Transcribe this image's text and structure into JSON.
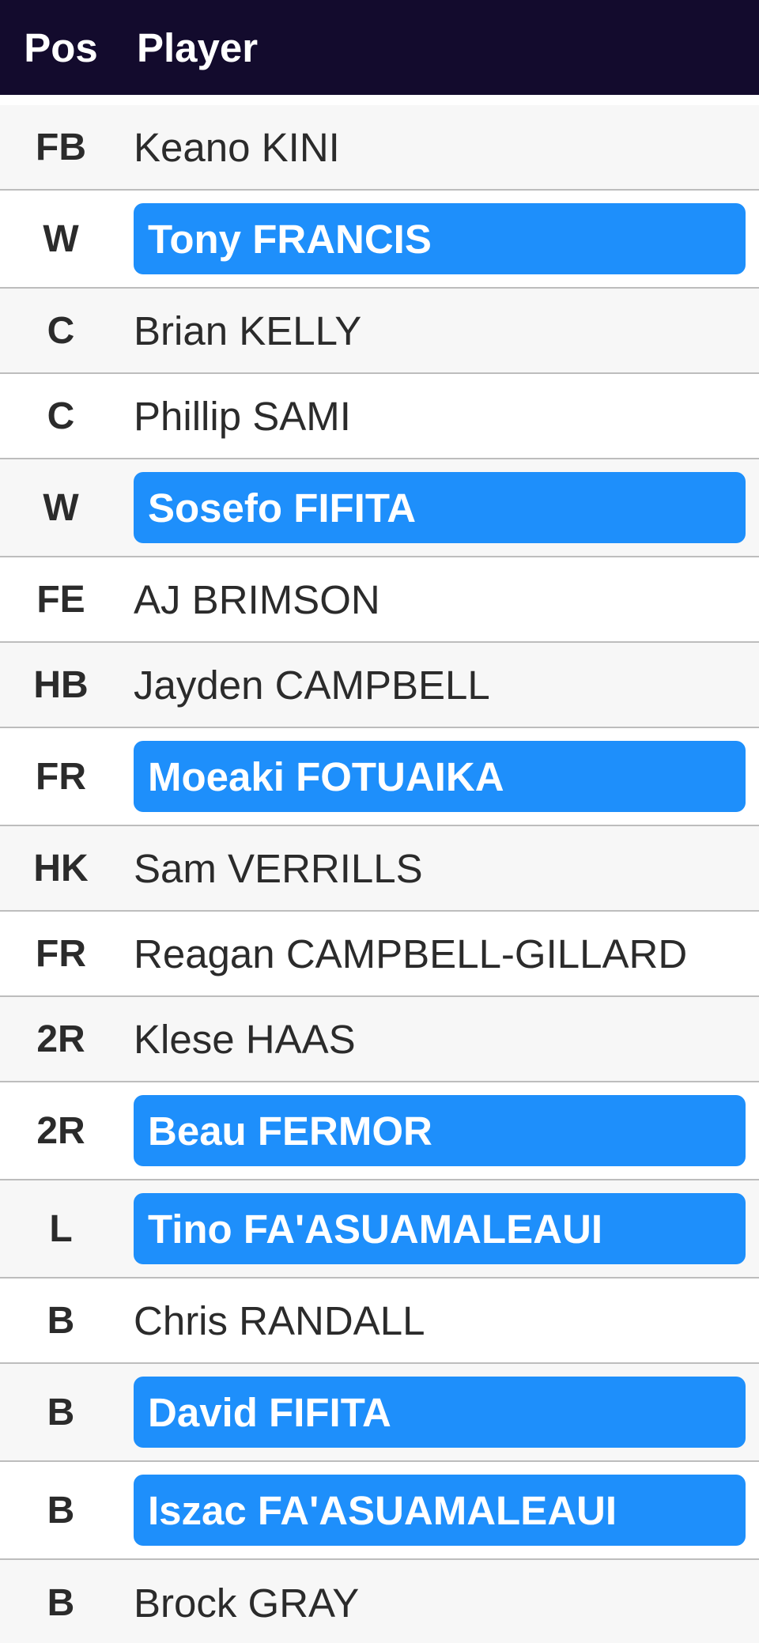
{
  "header": {
    "pos_label": "Pos",
    "player_label": "Player"
  },
  "colors": {
    "header_bg": "#130b2d",
    "highlight": "#1e8ffb"
  },
  "rows": [
    {
      "pos": "FB",
      "player": "Keano KINI",
      "highlight": false
    },
    {
      "pos": "W",
      "player": "Tony FRANCIS",
      "highlight": true
    },
    {
      "pos": "C",
      "player": "Brian KELLY",
      "highlight": false
    },
    {
      "pos": "C",
      "player": "Phillip SAMI",
      "highlight": false
    },
    {
      "pos": "W",
      "player": "Sosefo FIFITA",
      "highlight": true
    },
    {
      "pos": "FE",
      "player": "AJ BRIMSON",
      "highlight": false
    },
    {
      "pos": "HB",
      "player": "Jayden CAMPBELL",
      "highlight": false
    },
    {
      "pos": "FR",
      "player": "Moeaki FOTUAIKA",
      "highlight": true
    },
    {
      "pos": "HK",
      "player": "Sam VERRILLS",
      "highlight": false
    },
    {
      "pos": "FR",
      "player": "Reagan CAMPBELL-GILLARD",
      "highlight": false
    },
    {
      "pos": "2R",
      "player": "Klese HAAS",
      "highlight": false
    },
    {
      "pos": "2R",
      "player": "Beau FERMOR",
      "highlight": true
    },
    {
      "pos": "L",
      "player": "Tino FA'ASUAMALEAUI",
      "highlight": true
    },
    {
      "pos": "B",
      "player": "Chris RANDALL",
      "highlight": false
    },
    {
      "pos": "B",
      "player": "David FIFITA",
      "highlight": true
    },
    {
      "pos": "B",
      "player": "Iszac FA'ASUAMALEAUI",
      "highlight": true
    },
    {
      "pos": "B",
      "player": "Brock GRAY",
      "highlight": false
    }
  ]
}
